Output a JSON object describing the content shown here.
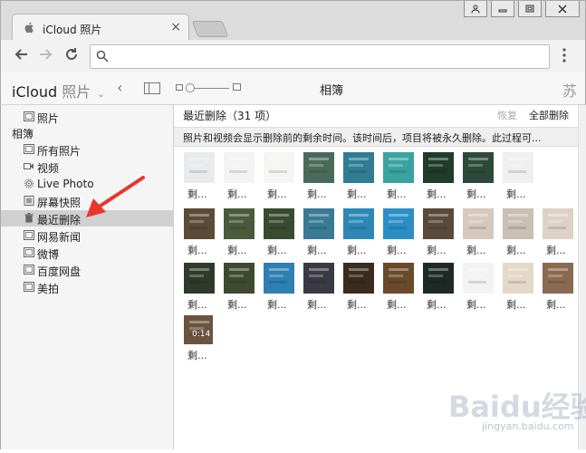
{
  "browser": {
    "tab_title": "iCloud 照片",
    "window_buttons": [
      "user",
      "minimize",
      "maximize",
      "close"
    ],
    "address_value": "",
    "icons": [
      "apple-icon",
      "back-arrow-icon",
      "forward-arrow-icon",
      "reload-icon",
      "search-icon",
      "menu-dots-icon"
    ]
  },
  "app": {
    "brand": "iCloud",
    "product": "照片",
    "view_title": "相簿",
    "user_name": "苏"
  },
  "sidebar": {
    "top_item": "照片",
    "section_heading": "相簿",
    "items": [
      {
        "label": "所有照片",
        "icon": "album-icon",
        "selected": false
      },
      {
        "label": "视频",
        "icon": "video-icon",
        "selected": false
      },
      {
        "label": "Live Photo",
        "icon": "live-photo-icon",
        "selected": false
      },
      {
        "label": "屏幕快照",
        "icon": "screenshot-icon",
        "selected": false
      },
      {
        "label": "最近删除",
        "icon": "trash-icon",
        "selected": true
      },
      {
        "label": "网易新闻",
        "icon": "album-icon",
        "selected": false
      },
      {
        "label": "微博",
        "icon": "album-icon",
        "selected": false
      },
      {
        "label": "百度网盘",
        "icon": "album-icon",
        "selected": false
      },
      {
        "label": "美拍",
        "icon": "album-icon",
        "selected": false
      }
    ]
  },
  "main": {
    "title": "最近删除（31 项）",
    "recover_label": "恢复",
    "delete_all_label": "全部删除",
    "notice": "照片和视频会显示删除前的剩余时间。该时间后，项目将被永久删除。此过程可...",
    "item_label": "剩...",
    "video_duration": "0:14",
    "thumb_colors": [
      "#e9eaee",
      "#f3f3f3",
      "#f5f5f3",
      "#4a6b5a",
      "#2f7d92",
      "#3aa3a0",
      "#1f3b2a",
      "#2c4a3a",
      "#efefef",
      "#5c4b38",
      "#4a5a3a",
      "#3b4a2f",
      "#3b7a95",
      "#2e88b5",
      "#2b8fc5",
      "#5a4a3a",
      "#d6c8bd",
      "#c9c0b3",
      "#ddd2c6",
      "#2f3a2a",
      "#3e4a2e",
      "#2e7fb2",
      "#3a3a44",
      "#3a2c1e",
      "#6a4a2a",
      "#1e2a25",
      "#f3f3f3",
      "#e4d8c8",
      "#8a6a50"
    ],
    "watermark": "Baidu经验",
    "watermark_sub": "jingyan.baidu.com"
  }
}
